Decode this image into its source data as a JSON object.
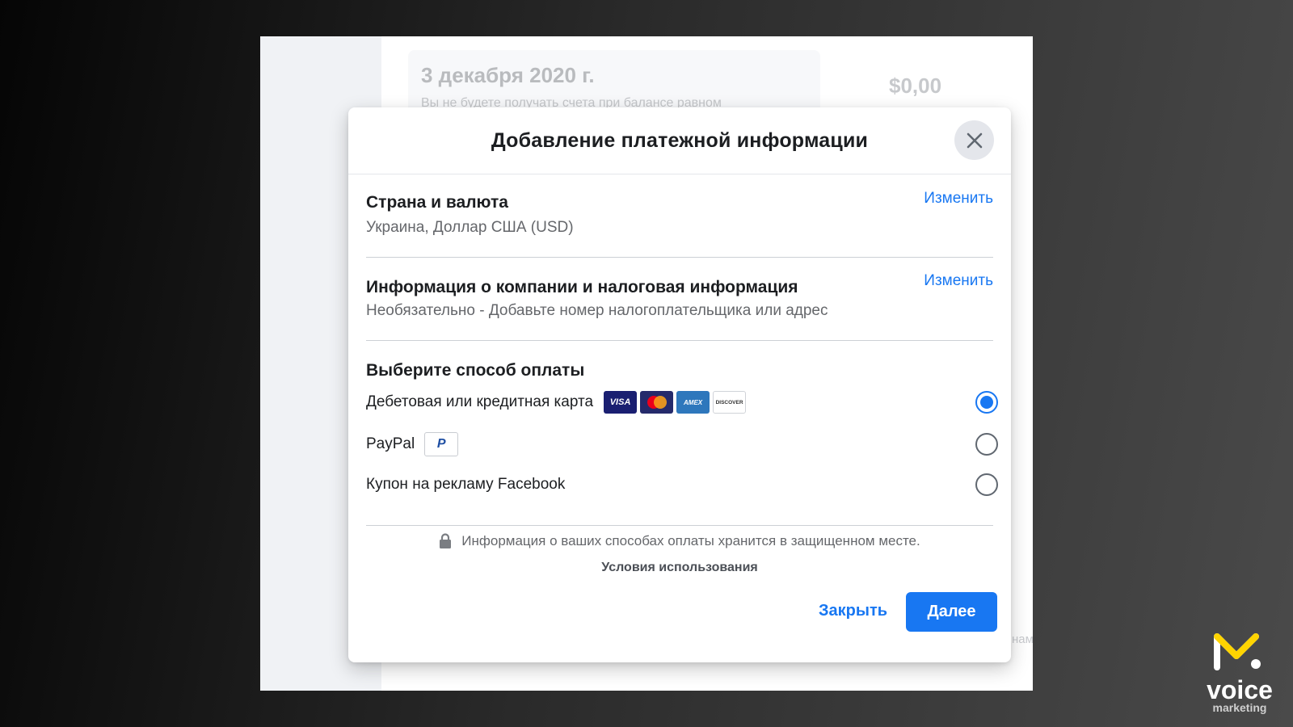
{
  "background": {
    "card_date": "3 декабря 2020 г.",
    "card_sub": "Вы не будете получать счета при балансе равном",
    "amount": "$0,00",
    "tail_text": "нам"
  },
  "modal": {
    "title": "Добавление платежной информации",
    "close_icon": "close-icon",
    "country": {
      "title": "Страна и валюта",
      "value": "Украина, Доллар США (USD)",
      "edit_label": "Изменить"
    },
    "business": {
      "title": "Информация о компании и налоговая информация",
      "value": "Необязательно - Добавьте номер налогоплательщика или адрес",
      "edit_label": "Изменить"
    },
    "payment": {
      "heading": "Выберите способ оплаты",
      "options": [
        {
          "label": "Дебетовая или кредитная карта",
          "selected": true
        },
        {
          "label": "PayPal",
          "selected": false
        },
        {
          "label": "Купон на рекламу Facebook",
          "selected": false
        }
      ],
      "card_logos": [
        "VISA",
        "mastercard",
        "AMEX",
        "DISCOVER"
      ],
      "paypal_logo": "P"
    },
    "secure_text": "Информация о ваших способах оплаты хранится в защищенном месте.",
    "terms_label": "Условия использования",
    "close_button": "Закрыть",
    "next_button": "Далее"
  },
  "brand": {
    "word": "voice",
    "sub": "marketing"
  },
  "colors": {
    "accent": "#1877f2",
    "brand_yellow": "#ffd400"
  }
}
